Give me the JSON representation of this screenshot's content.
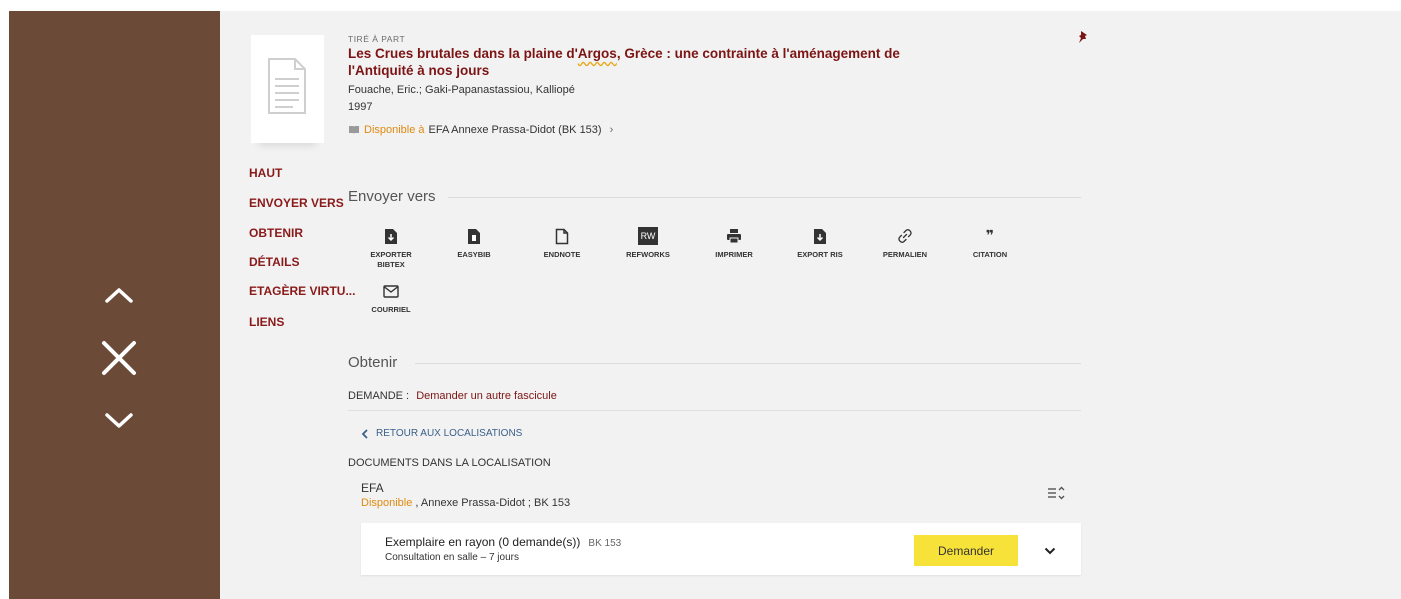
{
  "nav": {
    "up_icon": "chevron-up-icon",
    "close_icon": "close-icon",
    "down_icon": "chevron-down-icon"
  },
  "record": {
    "type": "TIRÉ À PART",
    "title_part1": "Les Crues brutales dans la plaine d'",
    "title_squiggle": "Argos",
    "title_part2": ", Grèce : une contrainte à l'aménagement de l'Antiquité à nos jours",
    "authors": "Fouache, Eric.; Gaki-Papanastassiou, Kalliopé",
    "year": "1997",
    "availability_status": "Disponible à",
    "availability_location": "EFA  Annexe Prassa-Didot (BK 153)",
    "availability_chevron": "›"
  },
  "jump_links": [
    "HAUT",
    "ENVOYER VERS",
    "OBTENIR",
    "DÉTAILS",
    "ETAGÈRE VIRTU...",
    "LIENS"
  ],
  "send_to": {
    "title": "Envoyer vers",
    "items": [
      {
        "label": "EXPORTER BIBTEX",
        "icon": "bibtex-file-icon"
      },
      {
        "label": "EASYBIB",
        "icon": "easybib-icon"
      },
      {
        "label": "ENDNOTE",
        "icon": "endnote-file-icon"
      },
      {
        "label": "REFWORKS",
        "icon": "refworks-icon",
        "icon_text": "RW"
      },
      {
        "label": "IMPRIMER",
        "icon": "print-icon"
      },
      {
        "label": "EXPORT RIS",
        "icon": "ris-file-icon"
      },
      {
        "label": "PERMALIEN",
        "icon": "link-icon"
      },
      {
        "label": "CITATION",
        "icon": "quote-icon",
        "icon_text": "❞"
      },
      {
        "label": "COURRIEL",
        "icon": "mail-icon"
      }
    ]
  },
  "obtain": {
    "title": "Obtenir",
    "demande_label": "DEMANDE :",
    "demande_link": "Demander un autre fascicule",
    "back_label": "RETOUR AUX LOCALISATIONS",
    "docs_title": "DOCUMENTS DANS LA LOCALISATION",
    "location_name": "EFA",
    "location_status": "Disponible",
    "location_detail": " , Annexe Prassa-Didot ; BK 153",
    "item": {
      "title": "Exemplaire en rayon (0 demande(s))",
      "call_number": "BK 153",
      "policy": "Consultation en salle – 7 jours",
      "request_button": "Demander"
    }
  }
}
